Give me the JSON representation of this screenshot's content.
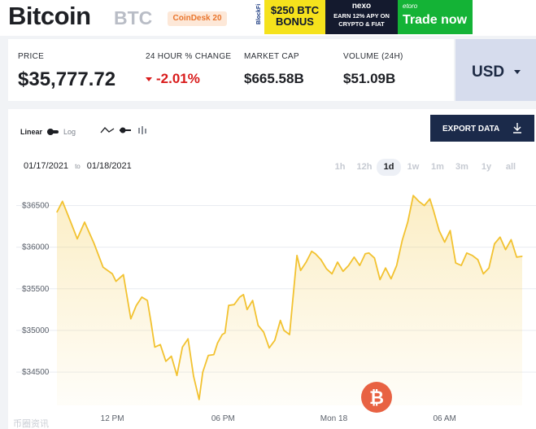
{
  "header": {
    "title": "Bitcoin",
    "ticker": "BTC",
    "badge": "CoinDesk 20",
    "ad": {
      "brand_small": "BlockFi",
      "bonus": "$250 BTC BONUS",
      "nexo": "nexo",
      "earn_line1": "EARN 12% APY ON",
      "earn_line2": "CRYPTO & FIAT",
      "etoro": "etoro",
      "trade": "Trade now"
    }
  },
  "stats": {
    "price_label": "PRICE",
    "price": "$35,777.72",
    "change_label": "24 HOUR % CHANGE",
    "change": "-2.01%",
    "cap_label": "MARKET CAP",
    "cap": "$665.58B",
    "volume_label": "VOLUME (24H)",
    "volume": "$51.09B"
  },
  "currency": "USD",
  "controls": {
    "scale_linear": "Linear",
    "scale_log": "Log",
    "export": "EXPORT DATA",
    "date_from": "01/17/2021",
    "date_to_word": "to",
    "date_to": "01/18/2021",
    "ranges": [
      "1h",
      "12h",
      "1d",
      "1w",
      "1m",
      "3m",
      "1y",
      "all"
    ],
    "active_range": "1d"
  },
  "colors": {
    "line": "#f2c230",
    "negative": "#d91c1c",
    "button": "#1b2a4a"
  },
  "chart_data": {
    "type": "area",
    "ylim": [
      34100,
      36700
    ],
    "y_ticks": [
      34500,
      35000,
      35500,
      36000,
      36500
    ],
    "y_tick_labels": [
      "$34500",
      "$35000",
      "$35500",
      "$36000",
      "$36500"
    ],
    "x_tick_labels": [
      "12 PM",
      "06 PM",
      "Mon 18",
      "06 AM"
    ],
    "x_tick_hours": [
      3,
      9,
      15,
      21
    ],
    "grid": true,
    "legend": "none",
    "series": [
      {
        "hours": [
          0,
          0.3,
          0.8,
          1.1,
          1.5,
          2.0,
          2.5,
          3.0,
          3.2,
          3.6,
          4.0,
          4.3,
          4.6,
          4.9,
          5.1,
          5.3,
          5.6,
          5.9,
          6.2,
          6.5,
          6.8,
          7.1,
          7.4,
          7.7,
          7.9,
          8.2,
          8.5,
          8.7,
          8.95,
          9.1,
          9.3,
          9.6,
          9.9,
          10.1,
          10.3,
          10.6,
          10.9,
          11.2,
          11.5,
          11.8,
          12.1,
          12.3,
          12.6,
          12.8,
          13.0,
          13.2,
          13.5,
          13.8,
          14.0,
          14.3,
          14.6,
          14.9,
          15.2,
          15.5,
          15.8,
          16.1,
          16.4,
          16.7,
          16.9,
          17.2,
          17.5,
          17.8,
          18.1,
          18.4,
          18.7,
          19.0,
          19.3,
          19.6,
          19.9,
          20.2,
          20.4,
          20.7,
          21.0,
          21.3,
          21.6,
          21.9,
          22.2,
          22.5,
          22.8,
          23.1,
          23.4,
          23.7,
          24.0,
          24.3,
          24.6,
          24.9,
          25.2
        ],
        "values": [
          36420,
          36550,
          36270,
          36100,
          36300,
          36050,
          35760,
          35680,
          35590,
          35670,
          35140,
          35300,
          35400,
          35360,
          35090,
          34800,
          34830,
          34630,
          34690,
          34460,
          34800,
          34900,
          34450,
          34170,
          34500,
          34700,
          34710,
          34850,
          34950,
          34970,
          35300,
          35310,
          35400,
          35430,
          35250,
          35360,
          35060,
          34980,
          34790,
          34880,
          35120,
          35000,
          34950,
          35420,
          35900,
          35720,
          35820,
          35950,
          35920,
          35850,
          35740,
          35680,
          35820,
          35710,
          35780,
          35880,
          35780,
          35920,
          35930,
          35870,
          35610,
          35750,
          35620,
          35780,
          36080,
          36300,
          36620,
          36550,
          36500,
          36580,
          36440,
          36200,
          36060,
          36200,
          35810,
          35780,
          35930,
          35900,
          35850,
          35680,
          35750,
          36040,
          36120,
          35970,
          36090,
          35880,
          35890
        ]
      }
    ]
  },
  "watermark": "币圈资讯"
}
